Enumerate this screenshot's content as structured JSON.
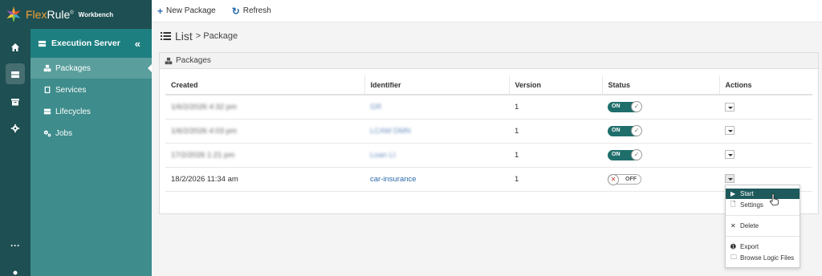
{
  "app": {
    "brand_flex": "Flex",
    "brand_rule": "Rule",
    "brand_reg": "®",
    "brand_sub": "Workbench",
    "brand_color": "#f2a23a",
    "rail_color": "#1e4f52",
    "accent": "#1e7f80"
  },
  "rail": {
    "icons": [
      "home-icon",
      "server-icon",
      "archive-icon",
      "gear-icon",
      "more-icon",
      "user-icon"
    ],
    "more_label": "···"
  },
  "sidebar": {
    "title": "Execution Server",
    "collapse_glyph": "«",
    "items": [
      {
        "label": "Packages",
        "icon": "cubes-icon",
        "active": true
      },
      {
        "label": "Services",
        "icon": "book-icon"
      },
      {
        "label": "Lifecycles",
        "icon": "server-icon"
      },
      {
        "label": "Jobs",
        "icon": "cogs-icon"
      }
    ]
  },
  "toolbar": {
    "new_package": "New Package",
    "new_icon": "+",
    "refresh": "Refresh",
    "refresh_icon": "↻"
  },
  "page": {
    "title": "List",
    "crumb": "> Package",
    "panel_title": "Packages"
  },
  "table": {
    "headers": [
      "Created",
      "Identifier",
      "Version",
      "Status",
      "Actions"
    ],
    "rows": [
      {
        "created": "1/6/2/2026 4:32 pm",
        "identifier": "GR",
        "version": "1",
        "status": "ON"
      },
      {
        "created": "1/6/2/2026 4:03 pm",
        "identifier": "LCAM DMN",
        "version": "1",
        "status": "ON"
      },
      {
        "created": "17/2/2026 1:21 pm",
        "identifier": "Loan LI",
        "version": "1",
        "status": "ON"
      },
      {
        "created": "18/2/2026 11:34 am",
        "identifier": "car-insurance",
        "version": "1",
        "status": "OFF"
      }
    ]
  },
  "menu": {
    "start": "Start",
    "settings": "Settings",
    "delete": "Delete",
    "export": "Export",
    "browse": "Browse Logic Files"
  }
}
